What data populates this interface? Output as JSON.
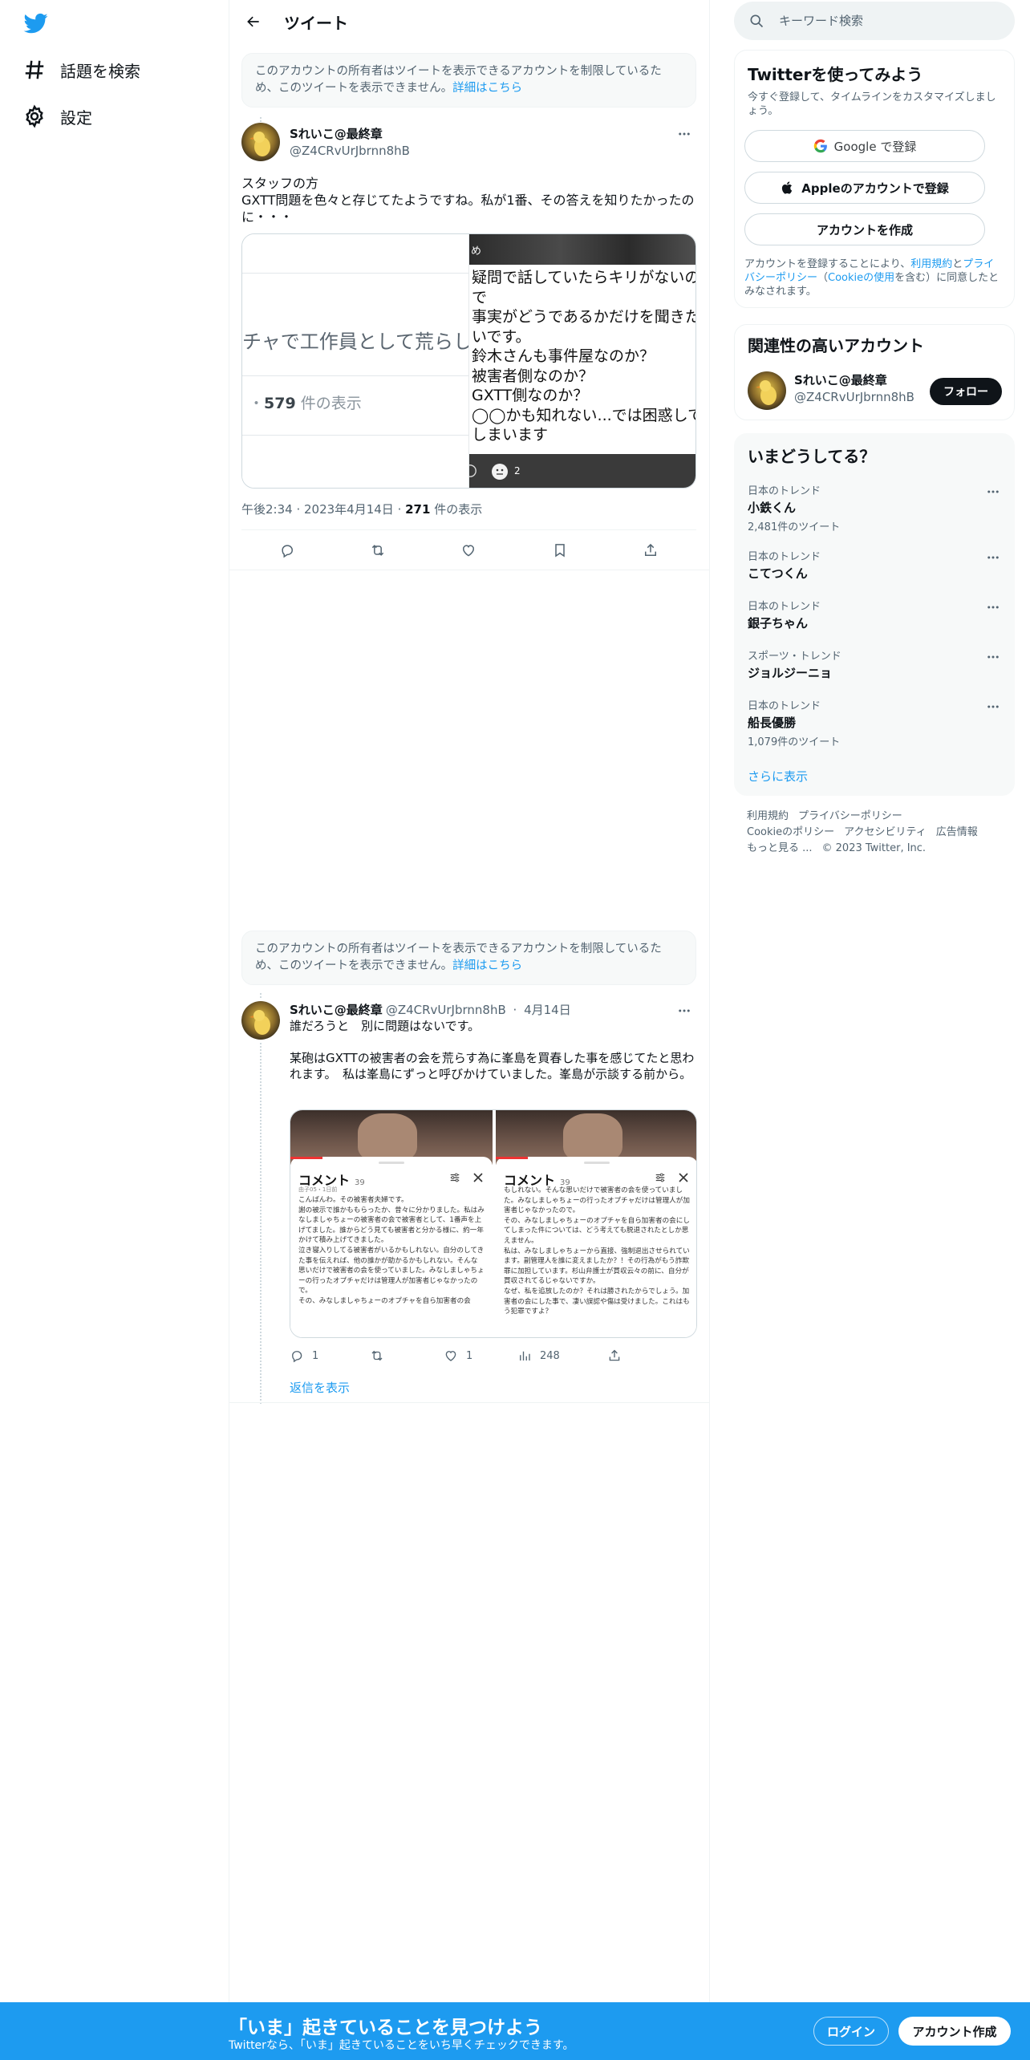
{
  "nav": {
    "explore_label": "話題を検索",
    "settings_label": "設定"
  },
  "header": {
    "title": "ツイート"
  },
  "notices": [
    {
      "text": "このアカウントの所有者はツイートを表示できるアカウントを制限しているため、このツイートを表示できません。",
      "link": "詳細はこちら"
    },
    {
      "text": "このアカウントの所有者はツイートを表示できるアカウントを制限しているため、このツイートを表示できません。",
      "link": "詳細はこちら"
    }
  ],
  "tweet1": {
    "display_name": "Sれいこ@最終章",
    "handle": "@Z4CRvUrJbrnn8hB",
    "text": "スタッフの方\nGXTT問題を色々と存じてたようですね。私が1番、その答えを知りたかったのに・・・",
    "card": {
      "left_text": "チャで工作員として荒らし",
      "views_count": "579",
      "views_suffix": " 件の表示",
      "views_prefix": "・",
      "top_fragment": "め",
      "body": "疑問で話していたらキリがないので\n事実がどうであるかだけを聞きたいです。\n鈴木さんも事件屋なのか？\n被害者側なのか？\nGXTT側なのか？\n◯◯かも知れない...では困惑してしまいます",
      "reaction_count": "2"
    },
    "time": "午後2:34",
    "date": "2023年4月14日",
    "views": "271",
    "views_label": " 件の表示"
  },
  "tweet2": {
    "display_name": "Sれいこ@最終章",
    "handle": "@Z4CRvUrJbrnn8hB",
    "date": "4月14日",
    "text": "誰だろうと　別に問題はないです。\n\n某砲はGXTTの被害者の会を荒らす為に峯島を買春した事を感じてたと思われます。　私は峯島にずっと呼びかけていました。峯島が示談する前から。",
    "media": [
      {
        "title": "コメント",
        "count": "39",
        "comment_meta": "由子05・1日前",
        "comment": "こんばんわ。その被害者夫婦です。\n謝の被示で誰かももらったか、昔々に分かりました。私はみなしましゃちょーの被害者の会で被害者として、1番声を上げてました。誰からどう見ても被害者と分かる様に、約一年かけて積み上げてきました。\n泣き寝入りしてる被害者がいるかもしれない。自分のしてきた事を伝えれば、他の誰かが助かるかもしれない。そんな思いだけで被害者の会を使っていました。みなしましゃちょーの行ったオプチャだけは管理人が加害者じゃなかったので。\nその、みなしましゃちょーのオプチャを自ら加害者の会"
      },
      {
        "title": "コメント",
        "count": "39",
        "comment": "もしれない。そんな思いだけで被害者の会を使っていました。みなしましゃちょーの行ったオプチャだけは管理人が加害者じゃなかったので。\nその、みなしましゃちょーのオプチャを自ら加害者の会にしてしまった件については、どう考えても脱退されたとしか思えません。\n私は、みなしましゃちょーから直接、強制退出させられています。副管理人を誰に変えましたか？！その行為がもう詐欺罪に加担しています。杉山弁護士が買収云々の前に、自分が買収されてるじゃないですか。\nなぜ、私を追放したのか？それは勝されたからでしょう。加害者の会にした事で、凄い誤認や傷は受けました。これはもう犯罪ですよ？"
      }
    ],
    "replies": "1",
    "likes": "1",
    "views": "248",
    "show_replies": "返信を表示"
  },
  "search": {
    "placeholder": "キーワード検索"
  },
  "signup_panel": {
    "title": "Twitterを使ってみよう",
    "subtitle": "今すぐ登録して、タイムラインをカスタマイズしましょう。",
    "google_label": "Google で登録",
    "apple_label": "Appleのアカウントで登録",
    "create_label": "アカウントを作成",
    "legal_pre": "アカウントを登録することにより、",
    "legal_terms": "利用規約",
    "legal_and": "と",
    "legal_privacy": "プライバシーポリシー",
    "legal_paren_open": "（",
    "legal_cookie": "Cookieの使用",
    "legal_post": "を含む）に同意したとみなされます。"
  },
  "relevant": {
    "title": "関連性の高いアカウント",
    "display_name": "Sれいこ@最終章",
    "handle": "@Z4CRvUrJbrnn8hB",
    "follow_label": "フォロー"
  },
  "trends": {
    "title": "いまどうしてる？",
    "items": [
      {
        "category": "日本のトレンド",
        "name": "小鉄くん",
        "count": "2,481件のツイート"
      },
      {
        "category": "日本のトレンド",
        "name": "こてつくん",
        "count": ""
      },
      {
        "category": "日本のトレンド",
        "name": "銀子ちゃん",
        "count": ""
      },
      {
        "category": "スポーツ・トレンド",
        "name": "ジョルジーニョ",
        "count": ""
      },
      {
        "category": "日本のトレンド",
        "name": "船長優勝",
        "count": "1,079件のツイート"
      }
    ],
    "show_more": "さらに表示"
  },
  "footer": {
    "terms": "利用規約",
    "privacy": "プライバシーポリシー",
    "cookie": "Cookieのポリシー",
    "accessibility": "アクセシビリティ",
    "ads": "広告情報",
    "more": "もっと見る ...",
    "copyright": "© 2023 Twitter, Inc."
  },
  "banner": {
    "title": "「いま」起きていることを見つけよう",
    "subtitle": "Twitterなら、「いま」起きていることをいち早くチェックできます。",
    "login_label": "ログイン",
    "signup_label": "アカウント作成"
  },
  "colors": {
    "accent": "#1d9bf0",
    "text": "#0f1419",
    "secondary": "#536471"
  }
}
